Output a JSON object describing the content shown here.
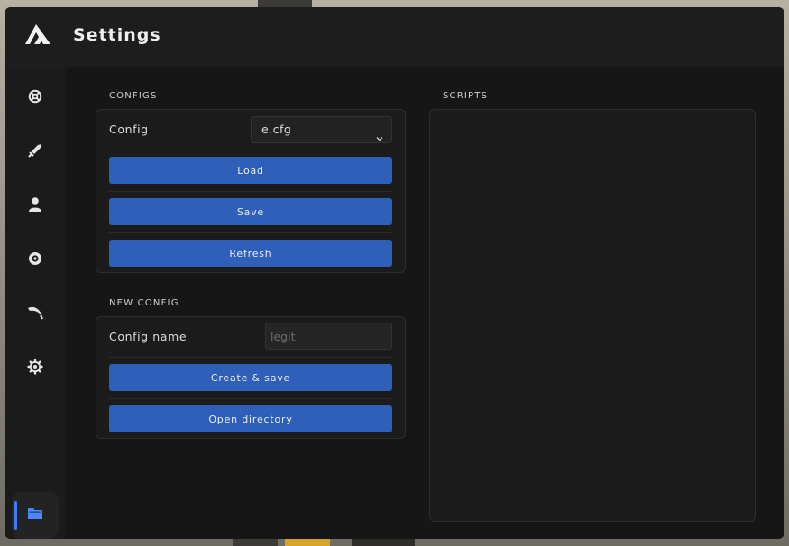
{
  "app": {
    "title": "Settings"
  },
  "sidebar": {
    "items": [
      {
        "icon": "life-ring-icon"
      },
      {
        "icon": "sword-icon"
      },
      {
        "icon": "user-icon"
      },
      {
        "icon": "eye-icon"
      },
      {
        "icon": "knife-icon"
      },
      {
        "icon": "gear-icon"
      },
      {
        "icon": "folder-icon",
        "active": true
      }
    ],
    "accent": "#3e7bff"
  },
  "configs": {
    "section_label": "CONFIGS",
    "config_label": "Config",
    "selected_config": "e.cfg",
    "load_label": "Load",
    "save_label": "Save",
    "refresh_label": "Refresh"
  },
  "new_config": {
    "section_label": "NEW CONFIG",
    "name_label": "Config name",
    "name_placeholder": "legit",
    "name_value": "",
    "create_label": "Create & save",
    "open_dir_label": "Open directory"
  },
  "scripts": {
    "section_label": "SCRIPTS",
    "items": []
  },
  "colors": {
    "button": "#2f5fb8",
    "panel": "#1b1b1c",
    "content_bg": "#161616"
  }
}
